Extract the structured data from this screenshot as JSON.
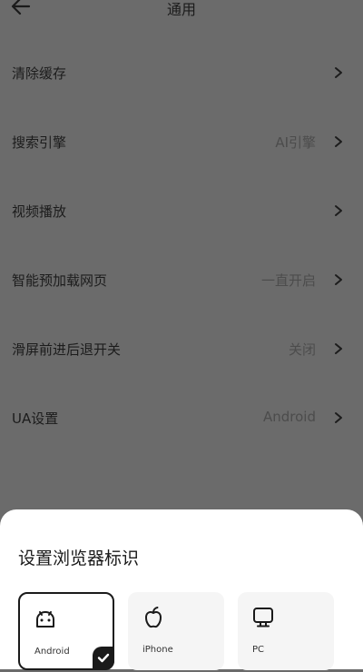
{
  "header": {
    "title": "通用"
  },
  "settings": [
    {
      "label": "清除缓存",
      "value": ""
    },
    {
      "label": "搜索引擎",
      "value": "AI引擎"
    },
    {
      "label": "视频播放",
      "value": ""
    },
    {
      "label": "智能预加载网页",
      "value": "一直开启"
    },
    {
      "label": "滑屏前进后退开关",
      "value": "关闭"
    },
    {
      "label": "UA设置",
      "value": "Android"
    }
  ],
  "sheet": {
    "title": "设置浏览器标识",
    "options": [
      {
        "label": "Android",
        "icon": "android-icon",
        "selected": true
      },
      {
        "label": "iPhone",
        "icon": "apple-icon",
        "selected": false
      },
      {
        "label": "PC",
        "icon": "monitor-icon",
        "selected": false
      }
    ]
  },
  "colors": {
    "overlay": "#6b6b6b",
    "sheet": "#ffffff",
    "accent": "#1a1a1a"
  }
}
